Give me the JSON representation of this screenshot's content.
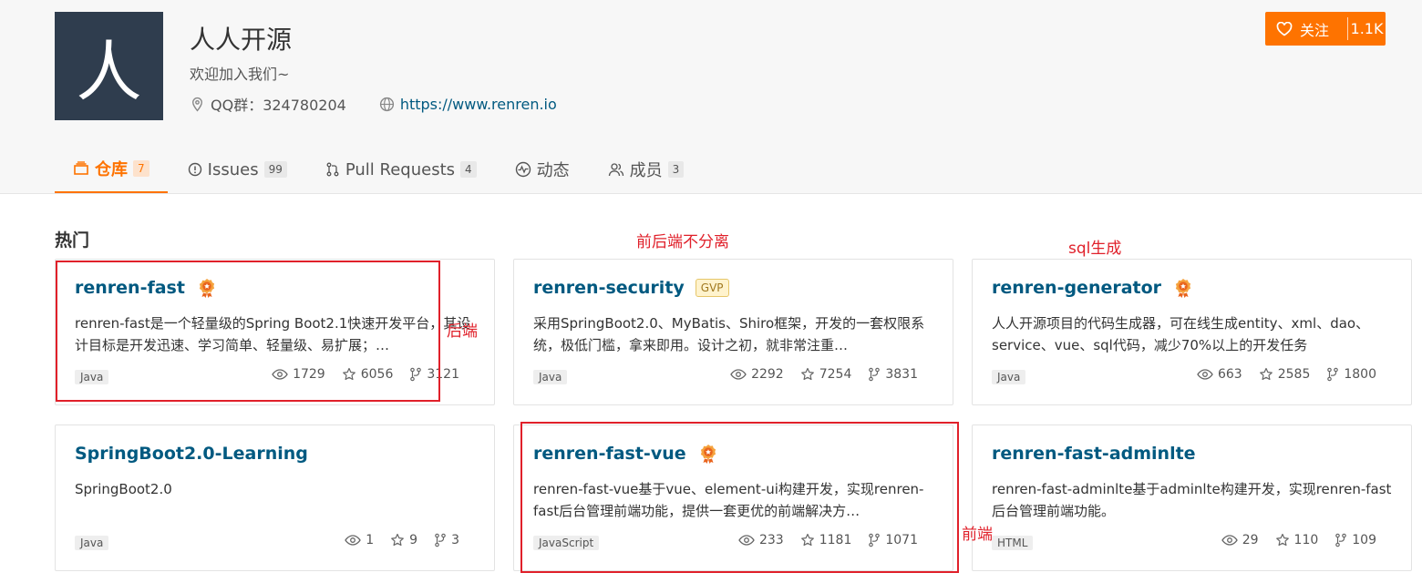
{
  "header": {
    "logo_char": "人",
    "org_name": "人人开源",
    "org_desc": "欢迎加入我们~",
    "qq_label": "QQ群：324780204",
    "website": "https://www.renren.io",
    "follow_label": "关注",
    "follow_count": "1.1K"
  },
  "tabs": [
    {
      "label": "仓库",
      "count": "7",
      "icon": "repo-icon",
      "active": true
    },
    {
      "label": "Issues",
      "count": "99",
      "icon": "issue-icon"
    },
    {
      "label": "Pull Requests",
      "count": "4",
      "icon": "pull-request-icon"
    },
    {
      "label": "动态",
      "count": "",
      "icon": "activity-icon"
    },
    {
      "label": "成员",
      "count": "3",
      "icon": "members-icon"
    }
  ],
  "section_title": "热门",
  "repos": [
    {
      "name": "renren-fast",
      "recommended": true,
      "gvp": "",
      "desc": "renren-fast是一个轻量级的Spring Boot2.1快速开发平台，其设计目标是开发迅速、学习简单、轻量级、易扩展；…",
      "lang": "Java",
      "watch": "1729",
      "star": "6056",
      "fork": "3121"
    },
    {
      "name": "renren-security",
      "recommended": false,
      "gvp": "GVP",
      "desc": "采用SpringBoot2.0、MyBatis、Shiro框架，开发的一套权限系统，极低门槛，拿来即用。设计之初，就非常注重…",
      "lang": "Java",
      "watch": "2292",
      "star": "7254",
      "fork": "3831"
    },
    {
      "name": "renren-generator",
      "recommended": true,
      "gvp": "",
      "desc": "人人开源项目的代码生成器，可在线生成entity、xml、dao、service、vue、sql代码，减少70%以上的开发任务",
      "lang": "Java",
      "watch": "663",
      "star": "2585",
      "fork": "1800"
    },
    {
      "name": "SpringBoot2.0-Learning",
      "recommended": false,
      "gvp": "",
      "desc": "SpringBoot2.0",
      "lang": "Java",
      "watch": "1",
      "star": "9",
      "fork": "3"
    },
    {
      "name": "renren-fast-vue",
      "recommended": true,
      "gvp": "",
      "desc": "renren-fast-vue基于vue、element-ui构建开发，实现renren-fast后台管理前端功能，提供一套更优的前端解决方…",
      "lang": "JavaScript",
      "watch": "233",
      "star": "1181",
      "fork": "1071"
    },
    {
      "name": "renren-fast-adminlte",
      "recommended": false,
      "gvp": "",
      "desc": "renren-fast-adminlte基于adminlte构建开发，实现renren-fast后台管理前端功能。",
      "lang": "HTML",
      "watch": "29",
      "star": "110",
      "fork": "109"
    }
  ],
  "annotations": {
    "backend": "后端",
    "no_separation": "前后端不分离",
    "sql_gen": "sql生成",
    "frontend": "前端"
  },
  "colors": {
    "accent": "#fe7300",
    "link": "#005980",
    "annotation_red": "#e0202a",
    "logo_bg": "#2f3d4e"
  }
}
